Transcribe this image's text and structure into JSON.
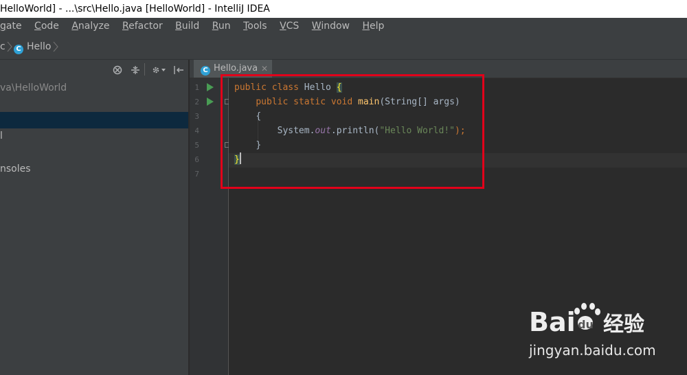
{
  "window": {
    "title": "HelloWorld] - ...\\src\\Hello.java [HelloWorld] - IntelliJ IDEA"
  },
  "menu": [
    "gate",
    "Code",
    "Analyze",
    "Refactor",
    "Build",
    "Run",
    "Tools",
    "VCS",
    "Window",
    "Help"
  ],
  "breadcrumb": {
    "prev": "c",
    "current": "Hello"
  },
  "sidebar": {
    "path": "va\\HelloWorld",
    "items": [
      "",
      "l",
      "nsoles"
    ]
  },
  "editor_tab": {
    "label": "Hello.java",
    "close": "✕"
  },
  "code": {
    "line_numbers": [
      "1",
      "2",
      "3",
      "4",
      "5",
      "6",
      "7"
    ],
    "lines": [
      {
        "kw": "public class ",
        "name": "Hello ",
        "brace": "{"
      },
      {
        "kw": "public static void ",
        "fn": "main",
        "rest": "(String[] args)"
      },
      {
        "text": "{"
      },
      {
        "pre": "System.",
        "it": "out",
        "mid": ".println(",
        "str": "\"Hello World!\"",
        "end": ");"
      },
      {
        "text": "}"
      },
      {
        "brace": "}"
      }
    ]
  },
  "watermark": {
    "logo": "Bai du 经验",
    "url": "jingyan.baidu.com"
  },
  "colors": {
    "annotation": "#e2001a",
    "run": "#499c54"
  }
}
